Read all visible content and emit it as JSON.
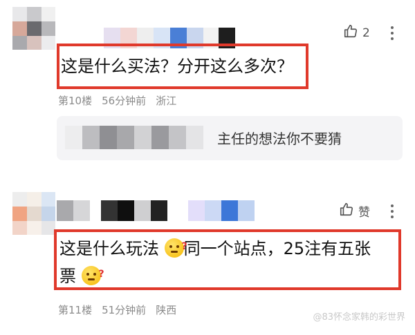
{
  "comments": [
    {
      "like_count": "2",
      "text": "这是什么买法？分开这么多次？",
      "floor": "第10楼",
      "time": "56分钟前",
      "location": "浙江",
      "reply": {
        "text": "主任的想法你不要猜"
      }
    },
    {
      "like_label": "赞",
      "text_line1": "这是什么玩法",
      "text_line1b": "同一个站点，25注有五张",
      "text_line2": "票",
      "emoji_mark": "?",
      "floor": "第11楼",
      "time": "51分钟前",
      "location": "陕西"
    }
  ],
  "watermark": "@83怀念家韩的彩世界",
  "colors": {
    "highlight": "#e0392b",
    "reply_bg": "#f4f4f6",
    "meta": "#8a8a8a"
  },
  "icons": [
    "thumbs-up-icon",
    "more-vertical-icon",
    "thinking-emoji-icon"
  ]
}
